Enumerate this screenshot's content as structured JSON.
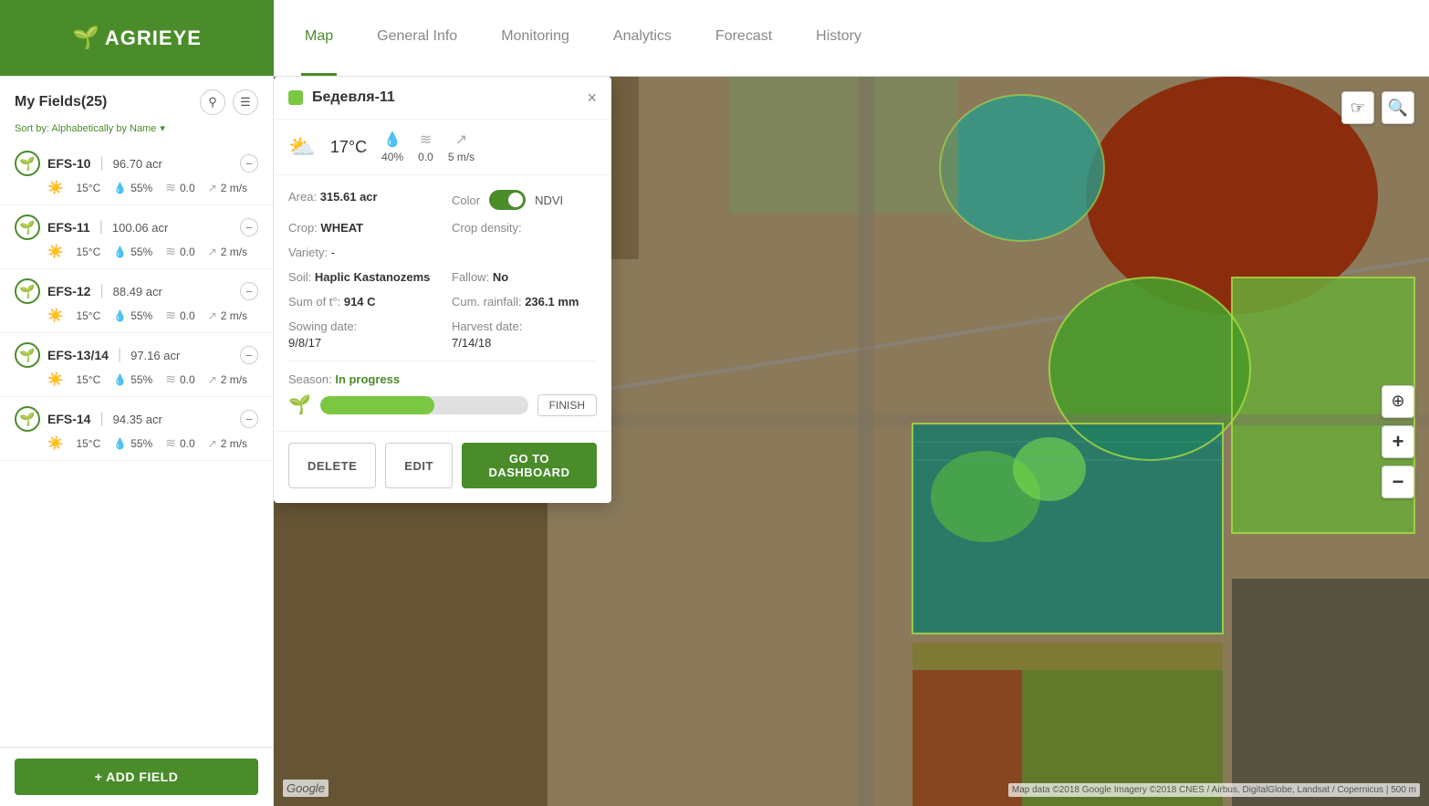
{
  "logo": {
    "icon": "🌱",
    "text": "AGRIEYE"
  },
  "nav": {
    "tabs": [
      {
        "id": "map",
        "label": "Map",
        "active": true
      },
      {
        "id": "general-info",
        "label": "General Info",
        "active": false
      },
      {
        "id": "monitoring",
        "label": "Monitoring",
        "active": false
      },
      {
        "id": "analytics",
        "label": "Analytics",
        "active": false
      },
      {
        "id": "forecast",
        "label": "Forecast",
        "active": false
      },
      {
        "id": "history",
        "label": "History",
        "active": false
      }
    ]
  },
  "sidebar": {
    "title": "My Fields(25)",
    "sort_label": "Sort by: Alphabetically by Name",
    "fields": [
      {
        "id": "EFS-10",
        "area": "96.70 acr",
        "weather_icon": "☀️",
        "temp": "15°C",
        "humidity": "55%",
        "humidity_icon": "💧",
        "wind_speed": "0.0",
        "wind_dir": "↗",
        "wind_label": "2 m/s",
        "icon_type": "seedling"
      },
      {
        "id": "EFS-11",
        "area": "100.06 acr",
        "weather_icon": "☀️",
        "temp": "15°C",
        "humidity": "55%",
        "humidity_icon": "💧",
        "wind_speed": "0.0",
        "wind_dir": "↗",
        "wind_label": "2 m/s",
        "icon_type": "seedling"
      },
      {
        "id": "EFS-12",
        "area": "88.49 acr",
        "weather_icon": "☀️",
        "temp": "15°C",
        "humidity": "55%",
        "humidity_icon": "💧",
        "wind_speed": "0.0",
        "wind_dir": "↗",
        "wind_label": "2 m/s",
        "icon_type": "seedling"
      },
      {
        "id": "EFS-13/14",
        "area": "97.16 acr",
        "weather_icon": "☀️",
        "temp": "15°C",
        "humidity": "55%",
        "humidity_icon": "💧",
        "wind_speed": "0.0",
        "wind_dir": "↗",
        "wind_label": "2 m/s",
        "icon_type": "seedling"
      },
      {
        "id": "EFS-14",
        "area": "94.35 acr",
        "weather_icon": "☀️",
        "temp": "15°C",
        "humidity": "55%",
        "humidity_icon": "💧",
        "wind_speed": "0.0",
        "wind_dir": "↗",
        "wind_label": "2 m/s",
        "icon_type": "seedling"
      }
    ],
    "add_field_label": "+ ADD FIELD"
  },
  "popup": {
    "title": "Бедевля-11",
    "color_dot": "#7bc742",
    "weather": {
      "icon": "⛅",
      "temp": "17°C",
      "humidity": "40%",
      "humidity_icon": "💧",
      "wind_speed": "0.0",
      "wind_label": "5 m/s",
      "wind_icon": "↗"
    },
    "area_label": "Area:",
    "area_value": "315.61 acr",
    "color_label": "Color",
    "ndvi_label": "NDVI",
    "crop_label": "Crop:",
    "crop_value": "WHEAT",
    "crop_density_label": "Crop density:",
    "crop_density_value": "",
    "variety_label": "Variety:",
    "variety_value": "-",
    "soil_label": "Soil:",
    "soil_value": "Haplic Kastanozems",
    "fallow_label": "Fallow:",
    "fallow_value": "No",
    "sum_temp_label": "Sum of t°:",
    "sum_temp_value": "914 C",
    "cum_rainfall_label": "Cum. rainfall:",
    "cum_rainfall_value": "236.1 mm",
    "sowing_label": "Sowing date:",
    "sowing_value": "9/8/17",
    "harvest_label": "Harvest date:",
    "harvest_value": "7/14/18",
    "season_label": "Season:",
    "season_status": "In progress",
    "progress_pct": 55,
    "finish_label": "FINISH",
    "delete_label": "DELETE",
    "edit_label": "EDIT",
    "dashboard_label": "GO TO DASHBOARD"
  },
  "map": {
    "google_label": "Google",
    "credit": "Map data ©2018 Google Imagery ©2018 CNES / Airbus, DigitalGlobe, Landsat / Copernicus | 500 m"
  }
}
